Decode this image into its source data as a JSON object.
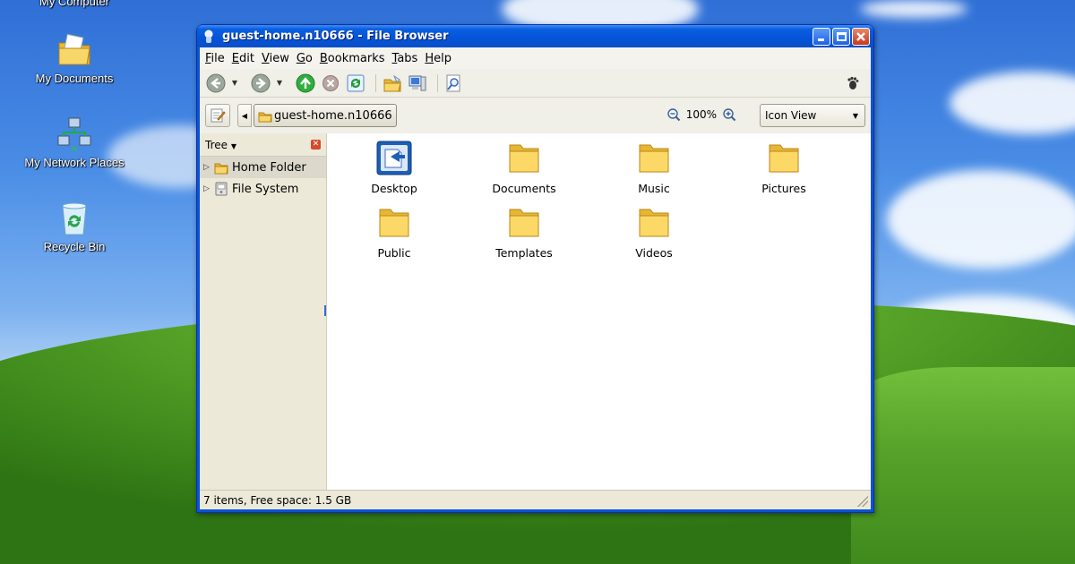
{
  "desktop": {
    "icons": [
      {
        "label": "My Computer",
        "icon": "my-computer-icon"
      },
      {
        "label": "My Documents",
        "icon": "folder-documents-icon"
      },
      {
        "label": "My Network Places",
        "icon": "network-places-icon"
      },
      {
        "label": "Recycle Bin",
        "icon": "recycle-bin-icon"
      }
    ]
  },
  "window": {
    "title": "guest-home.n10666 - File Browser",
    "menu": [
      {
        "key": "F",
        "rest": "ile"
      },
      {
        "key": "E",
        "rest": "dit"
      },
      {
        "key": "V",
        "rest": "iew"
      },
      {
        "key": "G",
        "rest": "o"
      },
      {
        "key": "B",
        "rest": "ookmarks"
      },
      {
        "key": "T",
        "rest": "abs"
      },
      {
        "key": "H",
        "rest": "elp"
      }
    ],
    "location": {
      "crumb": "guest-home.n10666",
      "zoom": "100%",
      "view_mode": "Icon View"
    },
    "sidebar": {
      "header": "Tree",
      "items": [
        {
          "label": "Home Folder"
        },
        {
          "label": "File System"
        }
      ]
    },
    "files": [
      {
        "name": "Desktop",
        "icon": "desktop-icon"
      },
      {
        "name": "Documents",
        "icon": "folder-icon"
      },
      {
        "name": "Music",
        "icon": "folder-icon"
      },
      {
        "name": "Pictures",
        "icon": "folder-icon"
      },
      {
        "name": "Public",
        "icon": "folder-icon"
      },
      {
        "name": "Templates",
        "icon": "folder-icon"
      },
      {
        "name": "Videos",
        "icon": "folder-icon"
      }
    ],
    "status": "7 items, Free space: 1.5 GB"
  }
}
